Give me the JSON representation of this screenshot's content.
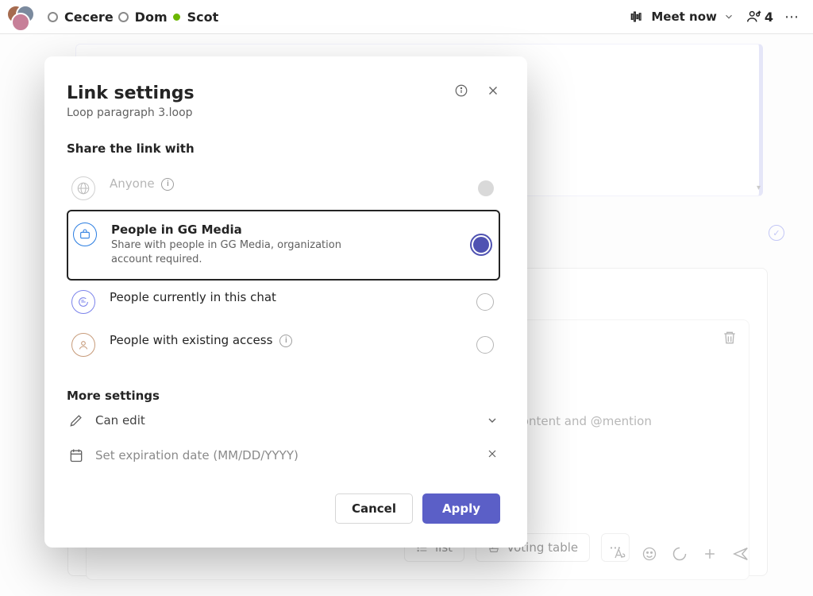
{
  "topbar": {
    "presence_names": [
      "Cecere",
      "Dom",
      "Scot"
    ],
    "meet_label": "Meet now",
    "people_count": "4"
  },
  "background": {
    "hint_text": ". Everyone can add content and @mention",
    "chip_list": "list",
    "chip_voting": "Voting table"
  },
  "dialog": {
    "title": "Link settings",
    "subtitle": "Loop paragraph 3.loop",
    "share_label": "Share the link with",
    "options": {
      "anyone": {
        "label": "Anyone"
      },
      "org": {
        "label": "People in GG Media",
        "desc": "Share with people in GG Media, organization account required."
      },
      "chat": {
        "label": "People currently in this chat"
      },
      "existing": {
        "label": "People with existing access"
      }
    },
    "more_label": "More settings",
    "edit_label": "Can edit",
    "expiry_placeholder": "Set expiration date (MM/DD/YYYY)",
    "cancel": "Cancel",
    "apply": "Apply"
  }
}
